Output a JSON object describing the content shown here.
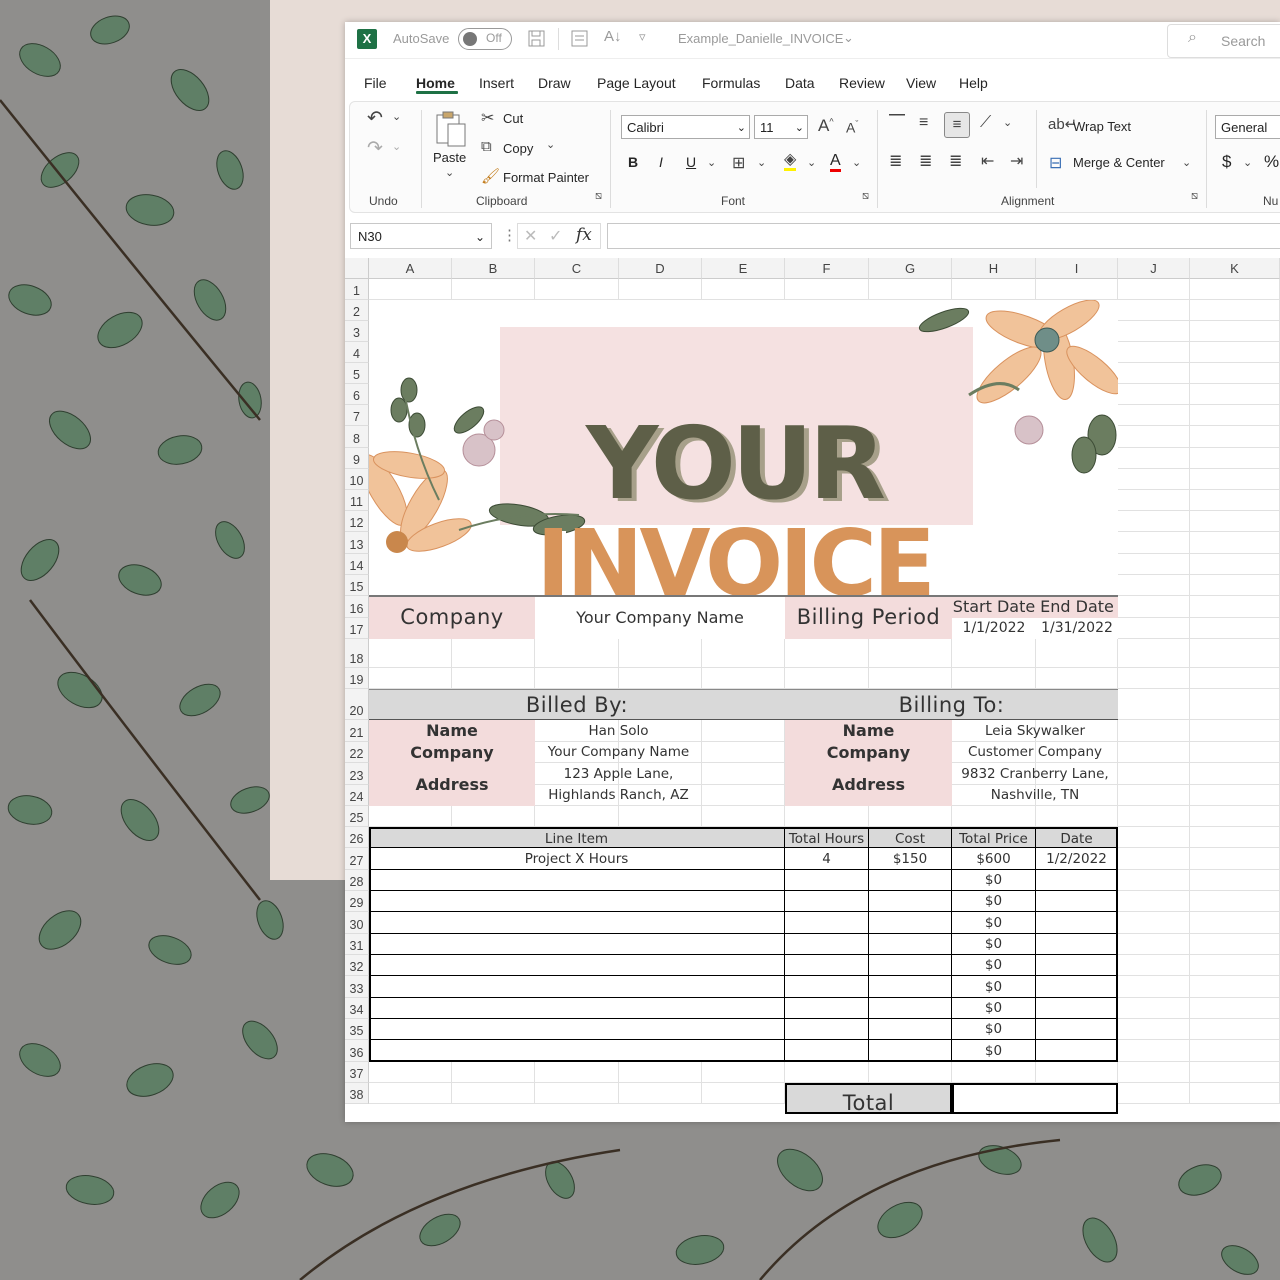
{
  "titlebar": {
    "autosave_label": "AutoSave",
    "autosave_state": "Off",
    "filename": "Example_Danielle_INVOICE",
    "search_placeholder": "Search"
  },
  "menu": [
    "File",
    "Home",
    "Insert",
    "Draw",
    "Page Layout",
    "Formulas",
    "Data",
    "Review",
    "View",
    "Help"
  ],
  "active_menu": "Home",
  "ribbon": {
    "undo_group": "Undo",
    "paste": "Paste",
    "cut": "Cut",
    "copy": "Copy",
    "format_painter": "Format Painter",
    "clipboard_group": "Clipboard",
    "font_name": "Calibri",
    "font_size": "11",
    "bold": "B",
    "italic": "I",
    "underline": "U",
    "font_color": "A",
    "grow_font": "A^",
    "shrink_font": "Aˇ",
    "font_group": "Font",
    "wrap_text": "Wrap Text",
    "merge_center": "Merge & Center",
    "alignment_group": "Alignment",
    "number_format": "General",
    "currency": "$",
    "percent": "%",
    "number_group": "Nu"
  },
  "formula_bar": {
    "name_box": "N30",
    "fx": "fx",
    "value": ""
  },
  "columns": [
    "A",
    "B",
    "C",
    "D",
    "E",
    "F",
    "G",
    "H",
    "I",
    "J",
    "K"
  ],
  "rows": [
    "1",
    "2",
    "3",
    "4",
    "5",
    "6",
    "7",
    "8",
    "9",
    "10",
    "11",
    "12",
    "13",
    "14",
    "15",
    "16",
    "17",
    "18",
    "19",
    "20",
    "21",
    "22",
    "23",
    "24",
    "25",
    "26",
    "27",
    "28",
    "29",
    "30",
    "31",
    "32",
    "33",
    "34",
    "35",
    "36",
    "37",
    "38"
  ],
  "banner": {
    "line1": "YOUR",
    "line2": "INVOICE",
    "line1_color": "#5e5f48",
    "line2_color": "#d8945a",
    "background": "#f5e1e1"
  },
  "invoice": {
    "company_label": "Company",
    "company_value": "Your Company Name",
    "billing_period_label": "Billing Period",
    "start_date_label": "Start Date",
    "end_date_label": "End Date",
    "start_date": "1/1/2022",
    "end_date": "1/31/2022",
    "billed_by_label": "Billed By:",
    "billing_to_label": "Billing To:",
    "by": {
      "name_label": "Name",
      "company_label": "Company",
      "address_label": "Address",
      "name": "Han Solo",
      "company": "Your Company Name",
      "address1": "123 Apple Lane,",
      "address2": "Highlands Ranch, AZ"
    },
    "to": {
      "name_label": "Name",
      "company_label": "Company",
      "address_label": "Address",
      "name": "Leia Skywalker",
      "company": "Customer Company",
      "address1": "9832 Cranberry Lane,",
      "address2": "Nashville, TN"
    },
    "table_headers": [
      "Line Item",
      "Total Hours",
      "Cost",
      "Total Price",
      "Date"
    ],
    "first_row": {
      "item": "Project X Hours",
      "hours": "4",
      "cost": "$150",
      "price": "$600",
      "date": "1/2/2022"
    },
    "empty_price": "$0",
    "total_label": "Total"
  }
}
